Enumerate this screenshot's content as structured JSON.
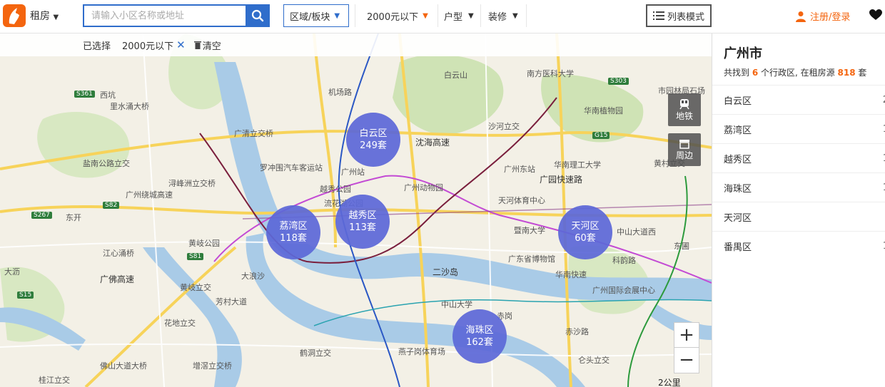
{
  "header": {
    "city_label": "租房",
    "search_placeholder": "请输入小区名称或地址",
    "filters": {
      "area": "区域/板块",
      "price": "2000元以下",
      "room_type": "户型",
      "decoration": "装修"
    },
    "list_mode": "列表模式",
    "login": "注册/登录",
    "accent_color": "#f4650f",
    "primary_color": "#2f6dcb"
  },
  "selection_bar": {
    "label": "已选择",
    "chip": "2000元以下",
    "clear": "清空"
  },
  "map": {
    "district_bubbles": [
      {
        "name": "白云区",
        "count": "249套"
      },
      {
        "name": "荔湾区",
        "count": "118套"
      },
      {
        "name": "越秀区",
        "count": "113套"
      },
      {
        "name": "天河区",
        "count": "60套"
      },
      {
        "name": "海珠区",
        "count": "162套"
      }
    ],
    "controls": {
      "subway": "地铁",
      "nearby": "周边",
      "zoom_in": "+",
      "zoom_out": "−",
      "scale": "2公里"
    },
    "labels": {
      "l01": "白云山",
      "l02": "南方医科大学",
      "l03": "华南植物园",
      "l04": "机场路",
      "l05": "广州站",
      "l06": "越秀公园",
      "l07": "流花湖公园",
      "l08": "广州动物园",
      "l09": "天河体育中心",
      "l10": "广州东站",
      "l11": "沙河立交",
      "l12": "华南理工大学",
      "l13": "暨南大学",
      "l14": "广东省博物馆",
      "l15": "二沙岛",
      "l16": "中山大学",
      "l17": "赤岗",
      "l18": "广州国际会展中心",
      "l19": "中山大道西",
      "l20": "东圃",
      "l21": "广清立交桥",
      "l22": "罗冲围汽车客运站",
      "l23": "浔峰洲立交桥",
      "l24": "盐南公路立交",
      "l25": "江心涌桥",
      "l26": "黄岐立交",
      "l27": "花地立交",
      "l28": "鹤洞立交",
      "l29": "佛山大道大桥",
      "l30": "增滘立交桥",
      "l31": "桂江立交",
      "l32": "沙河立交",
      "l33": "西坑",
      "l34": "里水涌大桥",
      "l35": "东开",
      "l36": "大沥",
      "l37": "芳村大道",
      "l38": "燕子岗体育场",
      "l39": "赤沙路",
      "l40": "仑头立交",
      "l41": "黄村立交",
      "l42": "市园林局石场",
      "l43": "华南快速",
      "l44": "广园快速路",
      "l45": "沈海高速",
      "l46": "广佛高速",
      "l47": "广州绕城高速",
      "l48": "科韵路",
      "l49": "黄岐公园",
      "l50": "大浪沙"
    },
    "road_shields": [
      "S361",
      "S303",
      "S82",
      "S267",
      "S81",
      "G15",
      "S15"
    ]
  },
  "sidebar": {
    "title": "广州市",
    "summary_prefix": "共找到",
    "district_count": "6",
    "summary_mid": "个行政区, 在租房源",
    "listing_count": "818",
    "summary_suffix": "套",
    "districts": [
      {
        "name": "白云区",
        "count": "2"
      },
      {
        "name": "荔湾区",
        "count": "1"
      },
      {
        "name": "越秀区",
        "count": "1"
      },
      {
        "name": "海珠区",
        "count": "1"
      },
      {
        "name": "天河区",
        "count": ""
      },
      {
        "name": "番禺区",
        "count": "1"
      }
    ]
  }
}
